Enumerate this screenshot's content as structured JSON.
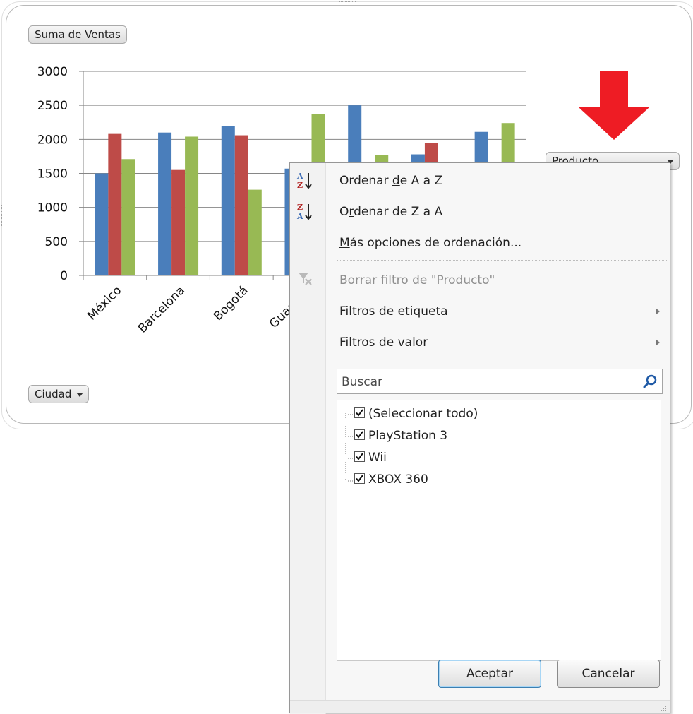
{
  "chart": {
    "value_field_label": "Suma de Ventas",
    "axis_field_label": "Ciudad",
    "legend_field_label": "Producto"
  },
  "chart_data": {
    "type": "bar",
    "ylim": [
      0,
      3000
    ],
    "yticks": [
      "0",
      "500",
      "1000",
      "1500",
      "2000",
      "2500",
      "3000"
    ],
    "categories": [
      "México",
      "Barcelona",
      "Bogotá",
      "Guadalajara",
      "",
      "",
      ""
    ],
    "category_labels_visible": [
      "México",
      "Barcelona",
      "Bogotá",
      "Guadalaj"
    ],
    "series": [
      {
        "values": [
          1500,
          2100,
          2200,
          1570,
          2500,
          1780,
          2110
        ],
        "color": "#4a7ebb"
      },
      {
        "values": [
          2080,
          1550,
          2060,
          null,
          null,
          1950,
          null
        ],
        "color": "#be4b48"
      },
      {
        "values": [
          1710,
          2040,
          1260,
          2370,
          1770,
          null,
          2240
        ],
        "color": "#98b954"
      }
    ],
    "grid": true
  },
  "menu": {
    "sort_az": {
      "pre": "Ordenar ",
      "u": "d",
      "post": "e A a Z"
    },
    "sort_za": {
      "pre": "O",
      "u": "r",
      "post": "denar de Z a A"
    },
    "more_sort": {
      "pre": "",
      "u": "M",
      "post": "ás opciones de ordenación..."
    },
    "clear_filter": {
      "pre": "",
      "u": "B",
      "post": "orrar filtro de \"Producto\""
    },
    "label_filters": {
      "pre": "",
      "u": "F",
      "post": "iltros de etiqueta"
    },
    "value_filters": {
      "pre": "",
      "u": "F",
      "post": "iltros de valor"
    },
    "search_placeholder": "Buscar",
    "items": [
      "(Seleccionar todo)",
      "PlayStation 3",
      "Wii",
      "XBOX 360"
    ],
    "ok_label": "Aceptar",
    "cancel_label": "Cancelar"
  },
  "icons": {
    "sort_az": "sort-ascending-icon",
    "sort_za": "sort-descending-icon",
    "clear_filter": "clear-filter-icon",
    "search": "search-icon",
    "annotation": "red-down-arrow"
  },
  "colors": {
    "annotation_arrow": "#ee1c24"
  }
}
